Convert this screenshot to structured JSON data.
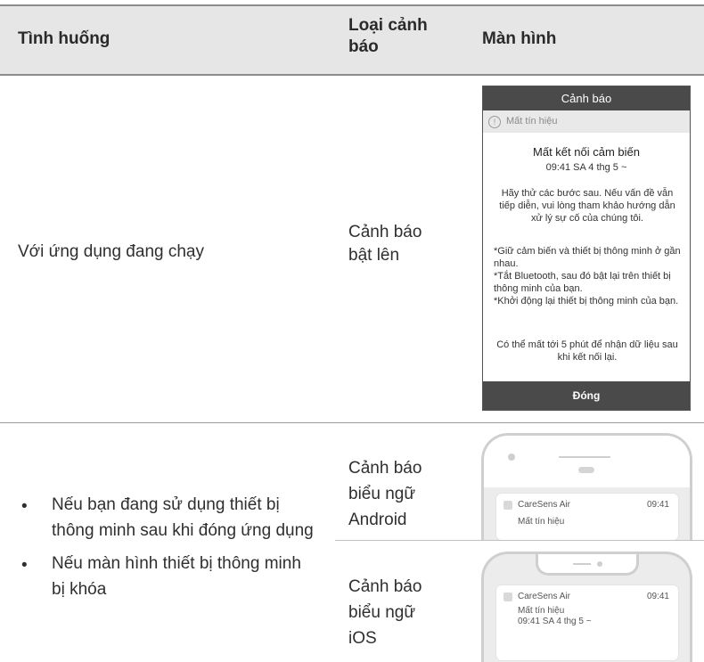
{
  "table": {
    "headers": [
      "Tình huống",
      "Loại cảnh\nbáo",
      "Màn hình"
    ],
    "row1": {
      "situation": "Với ứng dụng đang chạy",
      "alert_type": "Cảnh báo\nbật lên"
    },
    "row2": {
      "bullets": [
        "Nếu bạn đang sử dụng thiết bị\nthông minh sau khi đóng ứng dụng",
        "Nếu màn hình thiết bị thông minh\nbị khóa"
      ],
      "alert_type_android": "Cảnh báo\nbiểu ngữ\nAndroid",
      "alert_type_ios": "Cảnh báo\nbiểu ngữ\niOS"
    }
  },
  "popup": {
    "header": "Cảnh báo",
    "sub": "Mất tín hiệu",
    "title": "Mất kết nối cảm biến",
    "time": "09:41 SA 4 thg 5 ~",
    "para1": "Hãy thử các bước sau. Nếu vấn đề vẫn tiếp diễn, vui lòng tham khảo hướng dẫn xử lý sự cố của chúng tôi.",
    "para2": "*Giữ cảm biến và thiết bị thông minh ở gần nhau.\n*Tắt Bluetooth, sau đó bật lại trên thiết bị thông minh của bạn.\n*Khởi động lại thiết bị thông minh của bạn.",
    "para3": "Có thể mất tới 5 phút để nhận dữ liệu sau khi kết nối lại.",
    "close": "Đóng"
  },
  "android_banner": {
    "app": "CareSens Air",
    "time": "09:41",
    "message": "Mất tín hiệu"
  },
  "ios_banner": {
    "app": "CareSens Air",
    "time": "09:41",
    "message": "Mất tín hiệu",
    "subline": "09:41 SA 4 thg 5 ~"
  },
  "icons": {
    "warning": "warning-circle-icon",
    "app": "app-icon"
  }
}
